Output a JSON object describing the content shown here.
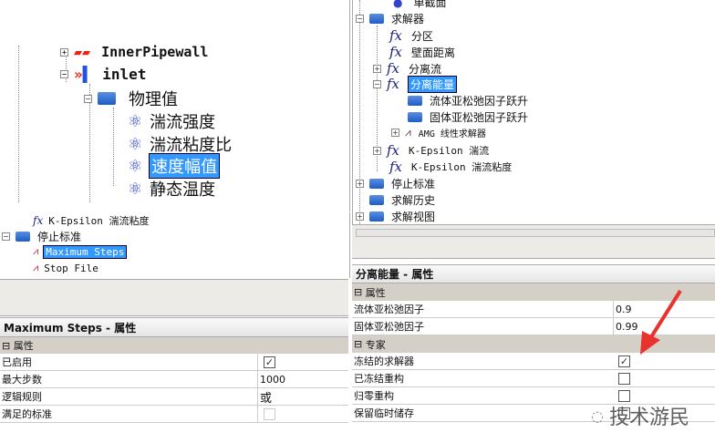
{
  "left_tree": {
    "items": [
      {
        "label": "InnerPipewall"
      },
      {
        "label": "inlet"
      },
      {
        "label": "物理值"
      },
      {
        "label": "湍流强度"
      },
      {
        "label": "湍流粘度比"
      },
      {
        "label": "速度幅值"
      },
      {
        "label": "静态温度"
      }
    ]
  },
  "left_tree2": {
    "items": [
      {
        "label": "K-Epsilon 湍流粘度"
      },
      {
        "label": "停止标准"
      },
      {
        "label": "Maximum Steps"
      },
      {
        "label": "Stop File"
      }
    ]
  },
  "left_props": {
    "title": "Maximum Steps - 属性",
    "section": "属性",
    "rows": [
      {
        "key": "已启用",
        "value": "checked"
      },
      {
        "key": "最大步数",
        "value": "1000"
      },
      {
        "key": "逻辑规则",
        "value": "或"
      },
      {
        "key": "满足的标准",
        "value": "disabled"
      }
    ]
  },
  "right_tree": {
    "items": [
      {
        "label": "单截面"
      },
      {
        "label": "求解器"
      },
      {
        "label": "分区"
      },
      {
        "label": "壁面距离"
      },
      {
        "label": "分离流"
      },
      {
        "label": "分离能量"
      },
      {
        "label": "流体亚松弛因子跃升"
      },
      {
        "label": "固体亚松弛因子跃升"
      },
      {
        "label": "AMG 线性求解器"
      },
      {
        "label": "K-Epsilon 湍流"
      },
      {
        "label": "K-Epsilon 湍流粘度"
      },
      {
        "label": "停止标准"
      },
      {
        "label": "求解历史"
      },
      {
        "label": "求解视图"
      }
    ]
  },
  "right_props": {
    "title": "分离能量 - 属性",
    "sections": [
      {
        "label": "属性",
        "rows": [
          {
            "key": "流体亚松弛因子",
            "value": "0.9"
          },
          {
            "key": "固体亚松弛因子",
            "value": "0.99"
          }
        ]
      },
      {
        "label": "专家",
        "rows": [
          {
            "key": "冻结的求解器",
            "value": "checked"
          },
          {
            "key": "已冻结重构",
            "value": "unchecked"
          },
          {
            "key": "归零重构",
            "value": "unchecked"
          },
          {
            "key": "保留临时储存",
            "value": "unchecked"
          }
        ]
      }
    ]
  },
  "watermark": "技术游民",
  "colors": {
    "selection": "#3399ff",
    "arrow": "#e8322e",
    "section": "#d4d0c8"
  }
}
